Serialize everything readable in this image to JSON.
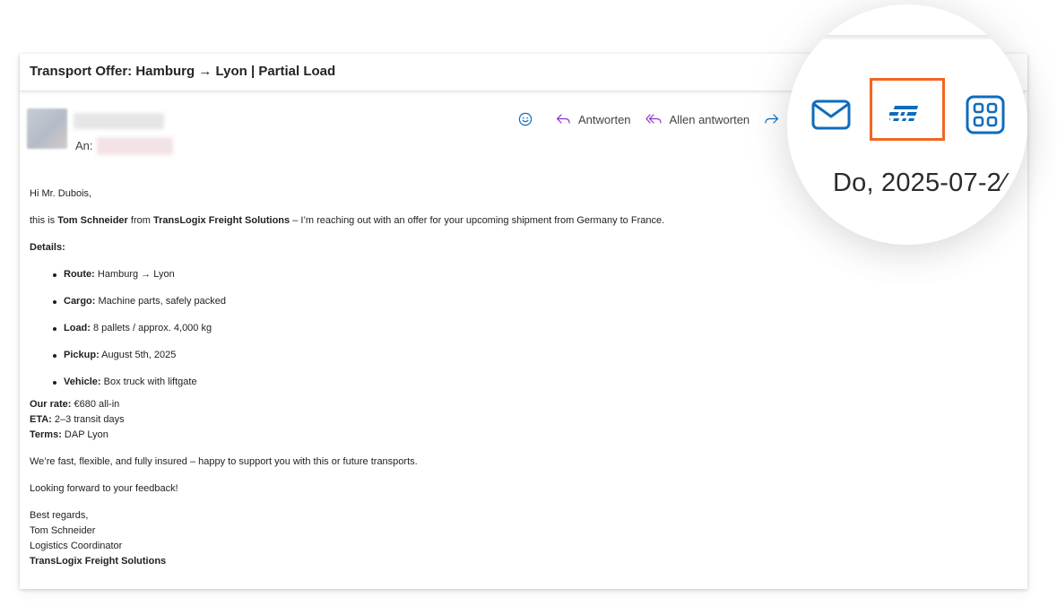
{
  "email": {
    "subject": "Transport Offer: Hamburg → Lyon | Partial Load",
    "to_label": "An:",
    "actions": {
      "react_icon": "smiley-icon",
      "reply_label": "Antworten",
      "reply_all_label": "Allen antworten",
      "forward_icon": "forward-icon"
    },
    "greeting": "Hi Mr. Dubois,",
    "intro": {
      "prefix": "this is ",
      "sender_name": "Tom Schneider",
      "middle": " from ",
      "company": "TransLogix Freight Solutions",
      "suffix": " – I’m reaching out with an offer for your upcoming shipment from Germany to France."
    },
    "details_heading": "Details:",
    "details": [
      {
        "label": "Route:",
        "value": " Hamburg → Lyon"
      },
      {
        "label": "Cargo:",
        "value": " Machine parts, safely packed"
      },
      {
        "label": "Load:",
        "value": " 8 pallets / approx. 4,000 kg"
      },
      {
        "label": "Pickup:",
        "value": " August 5th, 2025"
      },
      {
        "label": "Vehicle:",
        "value": " Box truck with liftgate"
      }
    ],
    "terms": [
      {
        "label": "Our rate:",
        "value": " €680 all-in"
      },
      {
        "label": "ETA:",
        "value": " 2–3 transit days"
      },
      {
        "label": "Terms:",
        "value": " DAP Lyon"
      }
    ],
    "pitch": "We’re fast, flexible, and fully insured – happy to support you with this or future transports.",
    "closing_line": "Looking forward to your feedback!",
    "signature": {
      "regards": "Best regards,",
      "name": "Tom Schneider",
      "title": "Logistics Coordinator",
      "company": "TransLogix Freight Solutions"
    }
  },
  "magnifier": {
    "icons": [
      "envelope-icon",
      "fast-delivery-icon",
      "apps-grid-icon"
    ],
    "highlighted_icon": "fast-delivery-icon",
    "highlight_color": "#f26522",
    "date_text": "Do, 2025-07-2⁄"
  },
  "colors": {
    "accent_blue": "#0f6cbd",
    "accent_purple": "#8b2fc9",
    "highlight_orange": "#f26522"
  }
}
